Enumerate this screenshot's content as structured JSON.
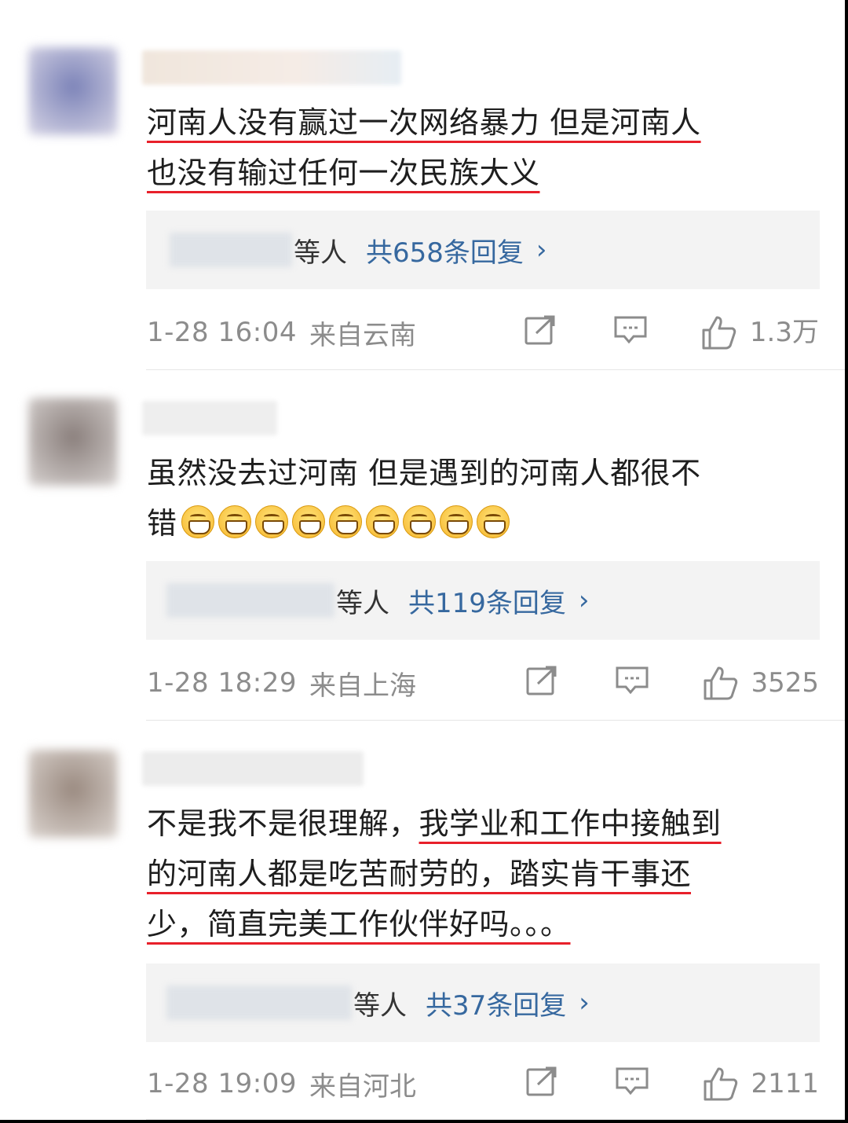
{
  "comments": [
    {
      "text_lines": [
        {
          "text": "河南人没有赢过一次网络暴力 但是河南人",
          "underlined": true
        },
        {
          "text": "也没有输过任何一次民族大义",
          "underlined": true
        }
      ],
      "reply_suffix": "等人",
      "reply_count": "共658条回复",
      "reply_arrow": "›",
      "time": "1-28 16:04",
      "location": "来自云南",
      "likes": "1.3万"
    },
    {
      "text_lines": [
        {
          "text": "虽然没去过河南 但是遇到的河南人都很不",
          "underlined": false
        },
        {
          "text": "错",
          "underlined": false
        }
      ],
      "emoji_name": "grin-emoji",
      "emoji_count": 9,
      "reply_suffix": "等人",
      "reply_count": "共119条回复",
      "reply_arrow": "›",
      "time": "1-28 18:29",
      "location": "来自上海",
      "likes": "3525"
    },
    {
      "text_lines": [
        {
          "plain": "不是我不是很理解，",
          "text": "我学业和工作中接触到",
          "underlined": true
        },
        {
          "text": "的河南人都是吃苦耐劳的，踏实肯干事还",
          "underlined": true
        },
        {
          "text": "少，简直完美工作伙伴好吗。。。",
          "underlined": true
        }
      ],
      "reply_suffix": "等人",
      "reply_count": "共37条回复",
      "reply_arrow": "›",
      "time": "1-28 19:09",
      "location": "来自河北",
      "likes": "2111"
    }
  ],
  "icons": [
    "share-icon",
    "comment-icon",
    "like-icon"
  ],
  "colors": {
    "link": "#36689f",
    "underline": "#e8202a",
    "meta": "#8c8c8c",
    "reply_bg": "#f3f3f3"
  }
}
